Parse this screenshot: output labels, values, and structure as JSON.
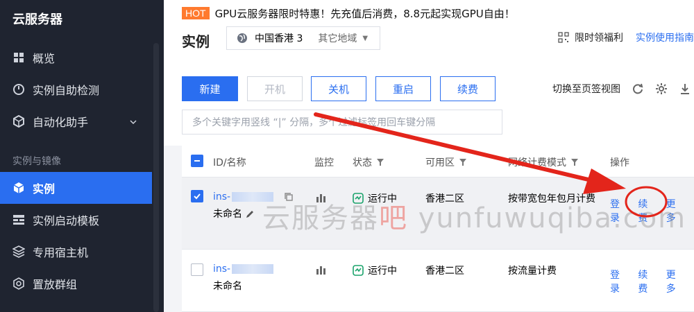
{
  "sidebar": {
    "title": "云服务器",
    "items": [
      {
        "label": "概览",
        "icon": "grid-icon"
      },
      {
        "label": "实例自助检测",
        "icon": "gauge-icon"
      },
      {
        "label": "自动化助手",
        "icon": "cube-icon"
      }
    ],
    "section": "实例与镜像",
    "section_items": [
      {
        "label": "实例",
        "icon": "cube-icon",
        "active": true
      },
      {
        "label": "实例启动模板",
        "icon": "template-icon"
      },
      {
        "label": "专用宿主机",
        "icon": "host-icon"
      },
      {
        "label": "置放群组",
        "icon": "group-icon"
      }
    ]
  },
  "banner": {
    "tag": "HOT",
    "text": "GPU云服务器限时特惠！先充值后消费，8.8元起实现GPU自由！"
  },
  "header": {
    "title": "实例",
    "region": "中国香港 3",
    "other_region": "其它地域",
    "benefit": "限时领福利",
    "guide": "实例使用指南"
  },
  "toolbar": {
    "new": "新建",
    "start": "开机",
    "stop": "关机",
    "restart": "重启",
    "renew": "续费",
    "switch_view": "切换至页签视图",
    "search_placeholder": "多个关键字用竖线 “|” 分隔，多个过滤标签用回车键分隔"
  },
  "table": {
    "columns": [
      "ID/名称",
      "监控",
      "状态",
      "可用区",
      "网络计费模式",
      "操作"
    ],
    "rows": [
      {
        "id": "ins-",
        "name": "未命名",
        "status": "运行中",
        "zone": "香港二区",
        "billing": "按带宽包年包月计费",
        "ops": [
          "登录",
          "续费",
          "更多"
        ]
      },
      {
        "id": "ins-",
        "name": "未命名",
        "status": "运行中",
        "zone": "香港二区",
        "billing": "按流量计费",
        "ops": [
          "登录",
          "续费",
          "更多"
        ]
      }
    ]
  },
  "watermark": {
    "part1": "云服务器",
    "part2": "吧",
    "part3": " yunfuwuqiba.com"
  },
  "colors": {
    "accent": "#2a6ef0",
    "sidebar_bg": "#1f2430",
    "hot": "#ff7a2e",
    "annotation": "#e3251b"
  }
}
